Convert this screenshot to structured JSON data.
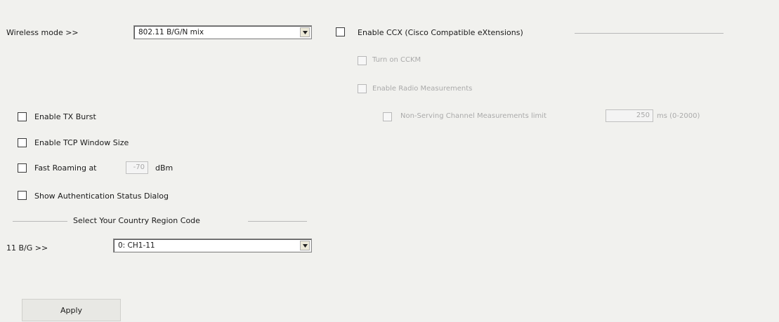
{
  "wireless_mode": {
    "label": "Wireless mode >>",
    "value": "802.11 B/G/N mix"
  },
  "ccx": {
    "enable_label": "Enable CCX (Cisco Compatible eXtensions)",
    "ckip_label": "Turn on CCKM",
    "radio_label": "Enable Radio Measurements",
    "nonserving_label": "Non-Serving Channel Measurements limit",
    "nonserving_value": "250",
    "nonserving_unit": "ms (0-2000)"
  },
  "options": {
    "tx_burst": "Enable TX Burst",
    "tcp_window": "Enable TCP Window Size",
    "fast_roaming": "Fast Roaming at",
    "fast_roaming_value": "-70",
    "fast_roaming_unit": "dBm",
    "auth_dialog": "Show Authentication Status Dialog"
  },
  "region": {
    "title": "Select Your Country Region Code",
    "label": "11 B/G >>",
    "value": "0: CH1-11"
  },
  "apply_label": "Apply"
}
